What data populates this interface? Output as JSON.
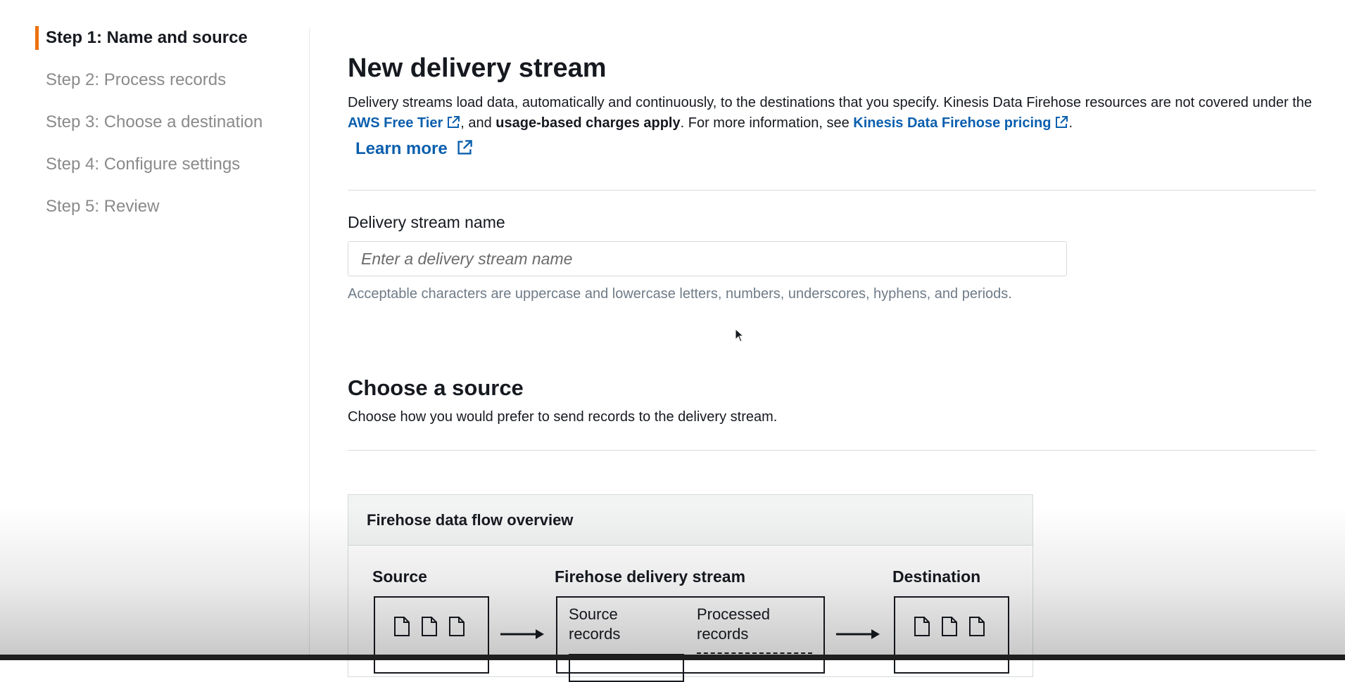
{
  "wizard": {
    "steps": [
      {
        "label": "Step 1: Name and source",
        "active": true
      },
      {
        "label": "Step 2: Process records",
        "active": false
      },
      {
        "label": "Step 3: Choose a destination",
        "active": false
      },
      {
        "label": "Step 4: Configure settings",
        "active": false
      },
      {
        "label": "Step 5: Review",
        "active": false
      }
    ]
  },
  "header": {
    "title": "New delivery stream",
    "desc_part1": "Delivery streams load data, automatically and continuously, to the destinations that you specify. Kinesis Data Firehose resources are not covered under the ",
    "free_tier_link": "AWS Free Tier",
    "desc_part2": ", and ",
    "desc_bold": "usage-based charges apply",
    "desc_part3": ". For more information, see ",
    "pricing_link": "Kinesis Data Firehose pricing",
    "desc_part4": ".",
    "learn_more": "Learn more"
  },
  "name_field": {
    "label": "Delivery stream name",
    "value": "",
    "placeholder": "Enter a delivery stream name",
    "hint": "Acceptable characters are uppercase and lowercase letters, numbers, underscores, hyphens, and periods."
  },
  "source_section": {
    "title": "Choose a source",
    "description": "Choose how you would prefer to send records to the delivery stream."
  },
  "overview": {
    "title": "Firehose data flow overview",
    "source_label": "Source",
    "stream_label": "Firehose delivery stream",
    "destination_label": "Destination",
    "source_records": "Source\nrecords",
    "processed_records": "Processed\nrecords"
  },
  "colors": {
    "accent": "#ec7211",
    "link": "#0b5fae",
    "text": "#16191f",
    "muted": "#8a8a8a"
  },
  "icons": [
    "external-link-icon",
    "document-icon",
    "arrow-right-icon",
    "mouse-cursor-icon"
  ]
}
